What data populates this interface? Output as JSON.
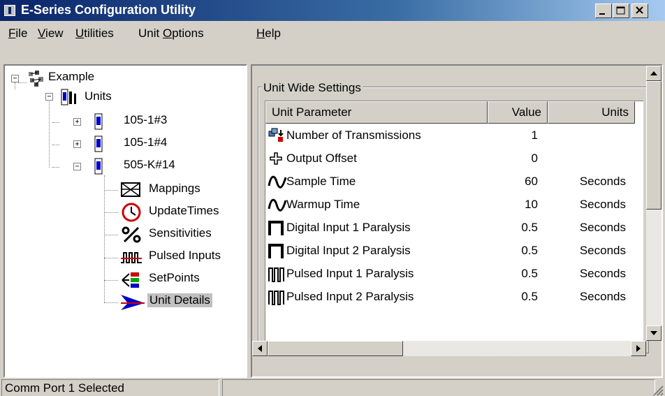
{
  "window": {
    "title": "E-Series Configuration Utility"
  },
  "menu": [
    {
      "label": "File",
      "accel": "F",
      "rest": "ile"
    },
    {
      "label": "View",
      "accel": "V",
      "rest": "iew"
    },
    {
      "label": "Utilities",
      "accel": "U",
      "rest": "tilities"
    },
    {
      "label": "Unit Options",
      "pre": "Unit ",
      "accel": "O",
      "rest": "ptions"
    },
    {
      "label": "Help",
      "accel": "H",
      "rest": "elp"
    }
  ],
  "tree": {
    "root": "Example",
    "units": "Units",
    "unit_items": [
      "105-1#3",
      "105-1#4",
      "505-K#14"
    ],
    "children": [
      "Mappings",
      "UpdateTimes",
      "Sensitivities",
      "Pulsed Inputs",
      "SetPoints",
      "Unit Details"
    ],
    "selected": "Unit Details"
  },
  "settings": {
    "group_title": "Unit Wide Settings",
    "columns": [
      "Unit Parameter",
      "Value",
      "Units"
    ],
    "rows": [
      {
        "param": "Number of Transmissions",
        "value": "1",
        "units": "",
        "icon": "transmission-icon"
      },
      {
        "param": "Output Offset",
        "value": "0",
        "units": "",
        "icon": "offset-cross-icon"
      },
      {
        "param": "Sample Time",
        "value": "60",
        "units": "Seconds",
        "icon": "wave-icon"
      },
      {
        "param": "Warmup Time",
        "value": "10",
        "units": "Seconds",
        "icon": "wave-icon"
      },
      {
        "param": "Digital Input 1 Paralysis",
        "value": "0.5",
        "units": "Seconds",
        "icon": "pulse-icon"
      },
      {
        "param": "Digital Input 2 Paralysis",
        "value": "0.5",
        "units": "Seconds",
        "icon": "pulse-icon"
      },
      {
        "param": "Pulsed Input 1 Paralysis",
        "value": "0.5",
        "units": "Seconds",
        "icon": "pulse-train-icon"
      },
      {
        "param": "Pulsed Input 2 Paralysis",
        "value": "0.5",
        "units": "Seconds",
        "icon": "pulse-train-icon"
      }
    ]
  },
  "status": {
    "text": "Comm Port 1 Selected",
    "second": ""
  },
  "colors": {
    "title_start": "#0a246a",
    "title_end": "#a6caf0",
    "face": "#d4d0c8",
    "selection": "#c0c0c0",
    "red_icon": "#cc0000",
    "blue_icon": "#0000cc"
  }
}
